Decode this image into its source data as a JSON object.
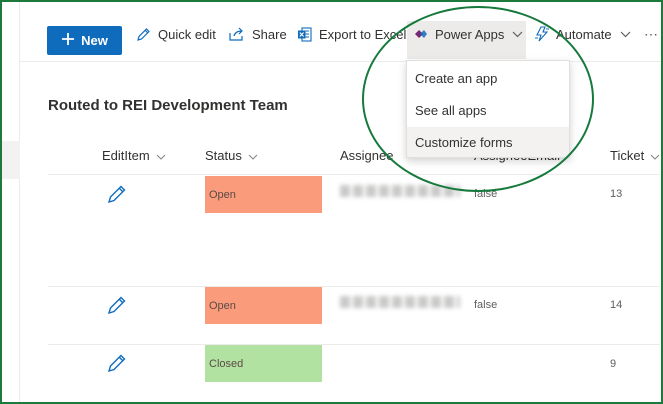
{
  "toolbar": {
    "new_label": "New",
    "quick_edit_label": "Quick edit",
    "share_label": "Share",
    "export_label": "Export to Excel",
    "power_apps_label": "Power Apps",
    "automate_label": "Automate",
    "more_label": "⋯"
  },
  "power_apps_menu": {
    "items": [
      "Create an app",
      "See all apps",
      "Customize forms"
    ],
    "highlighted": "Customize forms"
  },
  "list": {
    "title": "Routed to REI Development Team",
    "columns": [
      "EditItem",
      "Status",
      "Assignee",
      "AssigneeEmail",
      "Ticket"
    ],
    "rows": [
      {
        "status": "Open",
        "status_color": "#fa9b7c",
        "assignee_email": "false",
        "ticket": "13"
      },
      {
        "status": "Open",
        "status_color": "#fa9b7c",
        "assignee_email": "false",
        "ticket": "14"
      },
      {
        "status": "Closed",
        "status_color": "#b2e2a2",
        "assignee_email": "",
        "ticket": "9"
      }
    ]
  },
  "colors": {
    "accent": "#0f6cbd",
    "highlight_ring": "#157a3c",
    "status_open": "#fa9b7c",
    "status_closed": "#b2e2a2"
  },
  "icons": [
    "add-icon",
    "pencil-icon",
    "share-icon",
    "excel-icon",
    "power-apps-icon",
    "chevron-down-icon",
    "automate-icon",
    "more-icon",
    "edit-icon"
  ]
}
